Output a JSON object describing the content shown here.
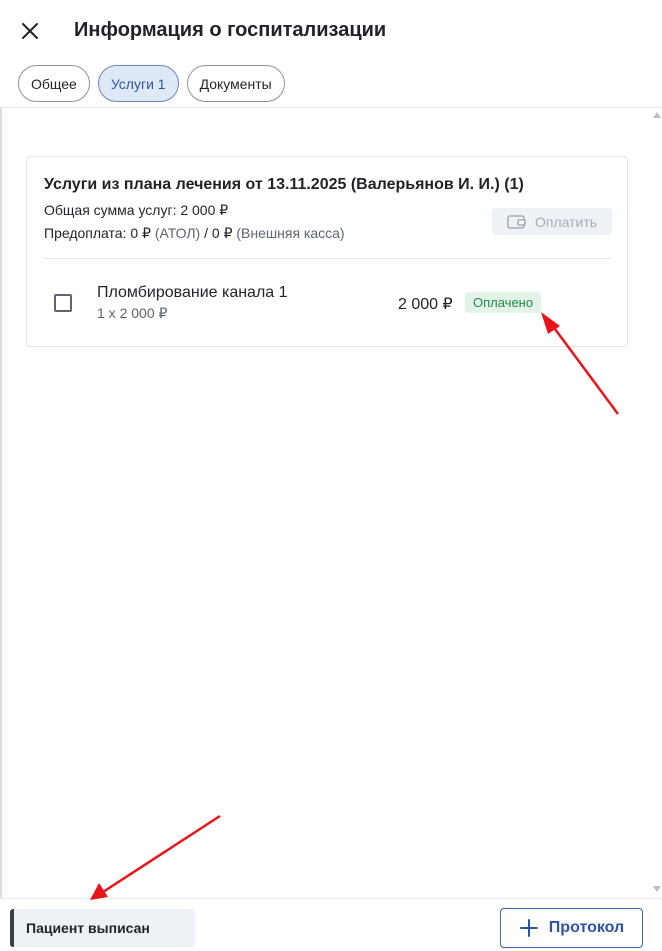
{
  "header": {
    "title": "Информация о госпитализации",
    "close_icon": "close-icon"
  },
  "tabs": [
    {
      "label": "Общее",
      "active": false
    },
    {
      "label": "Услуги 1",
      "active": true
    },
    {
      "label": "Документы",
      "active": false
    }
  ],
  "card": {
    "title": "Услуги из плана лечения от 13.11.2025 (Валерьянов И. И.) (1)",
    "sum": "Общая сумма услуг: 2 000 ₽",
    "prepay_main": "Предоплата: 0 ₽",
    "prepay_atol": "(АТОЛ)",
    "prepay_sep": "/ 0 ₽",
    "prepay_external": "(Внешняя касса)",
    "pay_button": {
      "label": "Оплатить",
      "icon": "wallet-icon"
    },
    "services": [
      {
        "name": "Пломбирование канала 1",
        "qty": "1 x 2 000 ₽",
        "price": "2 000 ₽",
        "status": "Оплачено"
      }
    ]
  },
  "footer": {
    "status": "Пациент выписан",
    "protocol_button": {
      "label": "Протокол",
      "icon": "plus-icon"
    }
  },
  "colors": {
    "accent": "#2c55a8",
    "paid_badge_bg": "#e3f3e8",
    "paid_badge_text": "#1e8a4c",
    "annotation_arrow": "#e8141a"
  }
}
